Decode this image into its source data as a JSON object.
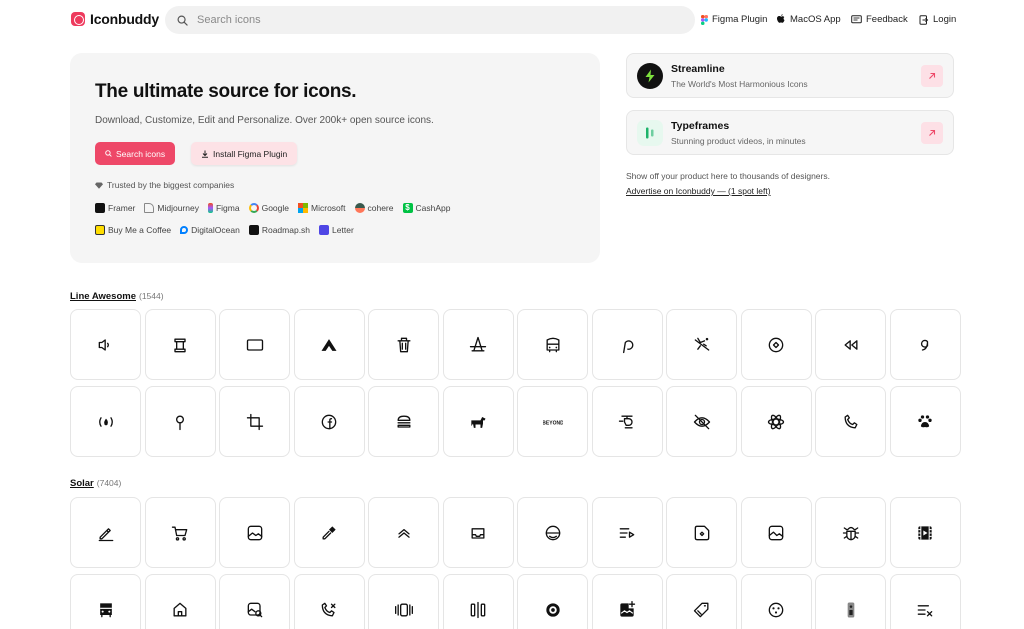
{
  "header": {
    "logo_text": "Iconbuddy",
    "search_placeholder": "Search icons",
    "nav": [
      {
        "label": "Figma Plugin",
        "icon": "figma-icon"
      },
      {
        "label": "MacOS App",
        "icon": "apple-icon"
      },
      {
        "label": "Feedback",
        "icon": "feedback-icon"
      },
      {
        "label": "Login",
        "icon": "login-icon"
      }
    ]
  },
  "hero": {
    "title": "The ultimate source for icons.",
    "subtitle": "Download, Customize, Edit and Personalize. Over 200k+ open source icons.",
    "search_button": "Search icons",
    "plugin_button": "Install Figma Plugin",
    "trusted": "Trusted by the biggest companies",
    "brands_row1": [
      "Framer",
      "Midjourney",
      "Figma",
      "Google",
      "Microsoft",
      "cohere",
      "CashApp"
    ],
    "brands_row2": [
      "Buy Me a Coffee",
      "DigitalOcean",
      "Roadmap.sh",
      "Letter"
    ]
  },
  "sponsors": [
    {
      "title": "Streamline",
      "subtitle": "The World's Most Harmonious Icons"
    },
    {
      "title": "Typeframes",
      "subtitle": "Stunning product videos, in minutes"
    }
  ],
  "advertise": {
    "text": "Show off your product here to thousands of designers.",
    "link": "Advertise on Iconbuddy — (1 spot left)"
  },
  "icon_sets": [
    {
      "name": "Line Awesome",
      "count": "(1544)",
      "icons": [
        "volume-icon",
        "scroll-icon",
        "tablet-icon",
        "caravan-icon",
        "trash-icon",
        "monument-icon",
        "bus-icon",
        "pied-piper-icon",
        "skiing-icon",
        "app-store-icon",
        "backward-icon",
        "gofore-icon",
        "campfire-icon",
        "map-pin-icon",
        "crop-icon",
        "facebook-icon",
        "hamburger-icon",
        "horse-icon",
        "beyond-logo-icon",
        "helicopter-icon",
        "eye-slash-icon",
        "atom-icon",
        "phone-icon",
        "paw-icon"
      ]
    },
    {
      "name": "Solar",
      "count": "(7404)",
      "icons": [
        "pen-icon",
        "cart-icon",
        "gallery-icon",
        "pipette-icon",
        "double-chevron-up-icon",
        "inbox-icon",
        "smile-icon",
        "playlist-icon",
        "sticker-icon",
        "wallet-icon",
        "bug-icon",
        "film-icon",
        "bus-front-icon",
        "home-icon",
        "gallery-search-icon",
        "phone-missed-icon",
        "carousel-icon",
        "slider-icon",
        "disc-icon",
        "gallery-add-icon",
        "tag-icon",
        "ball-icon",
        "remote-icon",
        "list-cross-icon"
      ]
    }
  ]
}
